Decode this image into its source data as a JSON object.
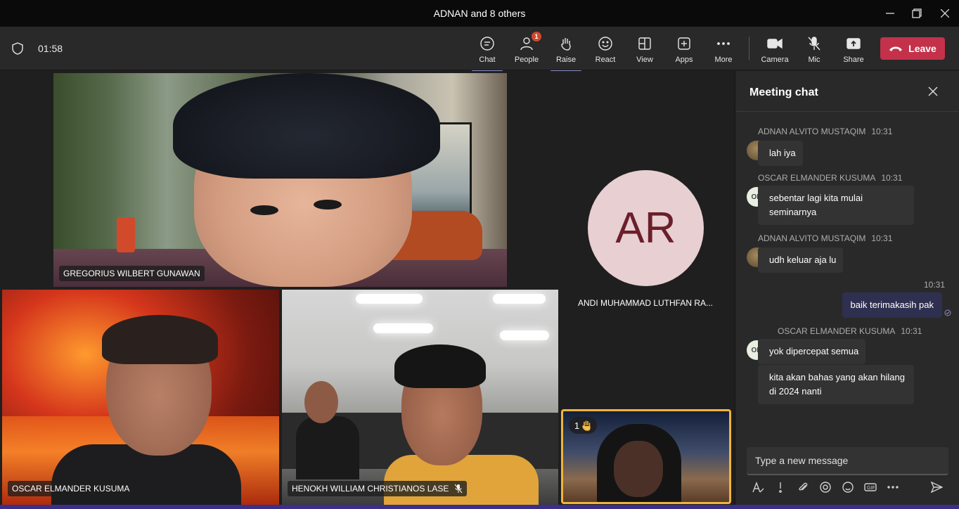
{
  "window": {
    "title": "ADNAN and 8 others"
  },
  "toolbar": {
    "timer": "01:58",
    "buttons": {
      "chat": "Chat",
      "people": "People",
      "people_badge": "1",
      "raise": "Raise",
      "react": "React",
      "view": "View",
      "apps": "Apps",
      "more": "More",
      "camera": "Camera",
      "mic": "Mic",
      "share": "Share"
    },
    "leave": "Leave"
  },
  "stage": {
    "tiles": [
      {
        "name": "GREGORIUS WILBERT GUNAWAN"
      },
      {
        "name": "ANDI MUHAMMAD LUTHFAN RA...",
        "initials": "AR"
      },
      {
        "name": "OSCAR ELMANDER KUSUMA"
      },
      {
        "name": "HENOKH WILLIAM CHRISTIANOS LASE"
      },
      {
        "raised_count": "1"
      }
    ]
  },
  "chat": {
    "title": "Meeting chat",
    "messages": [
      {
        "sender": "ADNAN ALVITO MUSTAQIM",
        "time": "10:31",
        "text": "lah iya"
      },
      {
        "sender": "OSCAR ELMANDER KUSUMA",
        "time": "10:31",
        "text": "sebentar lagi kita mulai seminarnya"
      },
      {
        "sender": "ADNAN ALVITO MUSTAQIM",
        "time": "10:31",
        "text": "udh keluar aja lu"
      },
      {
        "sender": "",
        "time": "10:31",
        "text": "baik terimakasih pak"
      },
      {
        "sender": "OSCAR ELMANDER KUSUMA",
        "time": "10:31",
        "text": "yok dipercepat semua"
      },
      {
        "sender": "",
        "time": "",
        "text": "kita akan bahas yang akan hilang di 2024 nanti"
      }
    ],
    "avatar_initials": "OK",
    "compose_placeholder": "Type a new message"
  },
  "colors": {
    "leave": "#c4314b",
    "accent": "#8b8cc7",
    "raised_border": "#f0b43c"
  }
}
